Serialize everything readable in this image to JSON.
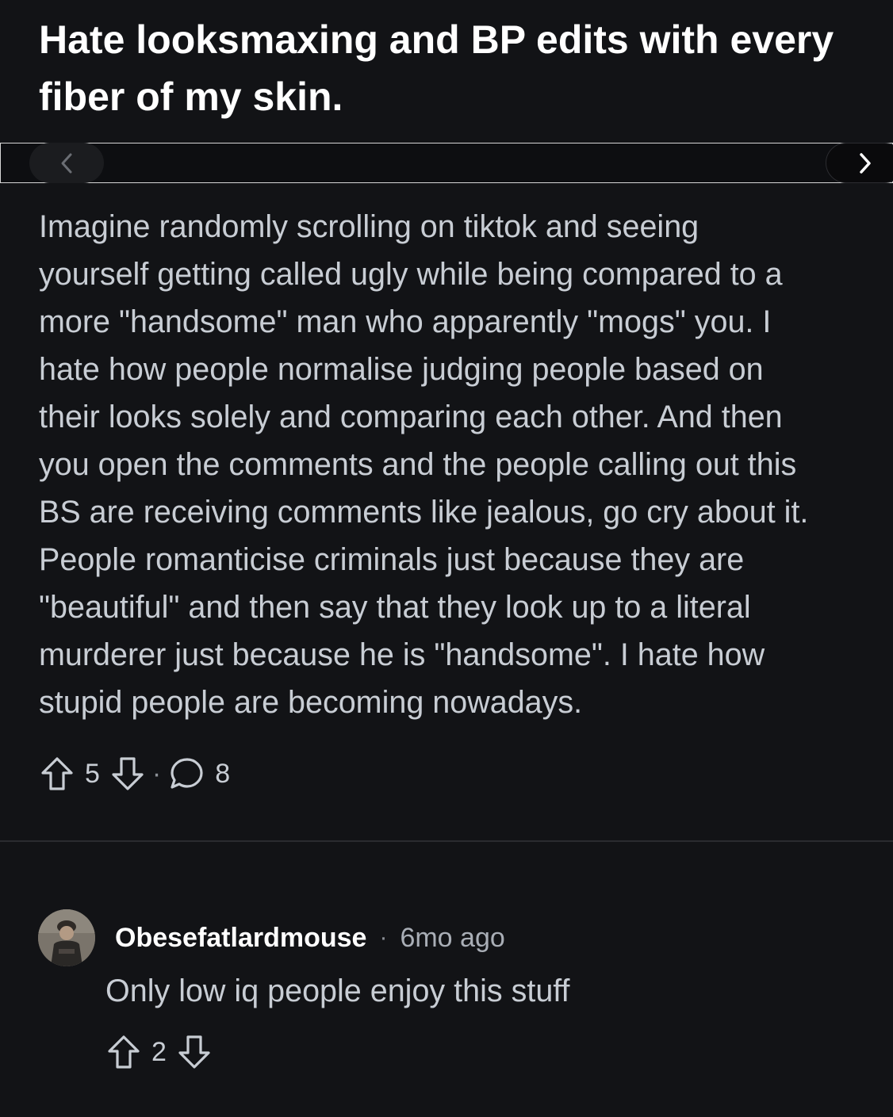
{
  "post": {
    "title": "Hate looksmaxing and BP edits with every fiber of my skin.",
    "body_lines": [
      "Imagine randomly scrolling on tiktok and seeing",
      "yourself getting called ugly while being compared to a",
      "more \"handsome\" man who apparently \"mogs\" you. I",
      "hate how people normalise judging people based on",
      "their looks solely and comparing each other. And then",
      "you open the comments and the people calling out this",
      "BS are receiving comments like jealous, go cry about it.",
      "People romanticise criminals just because they are",
      "\"beautiful\" and then say that they look up to a literal",
      "murderer just because he is \"handsome\". I hate how",
      "stupid people are becoming nowadays."
    ],
    "upvotes": "5",
    "separator": "·",
    "comments": "8"
  },
  "carousel": {
    "prev_icon": "chevron-left-icon",
    "next_icon": "chevron-right-icon"
  },
  "comment": {
    "author": "Obesefatlardmouse",
    "separator": "·",
    "age": "6mo ago",
    "text": "Only low iq people enjoy this stuff",
    "upvotes": "2"
  },
  "colors": {
    "background": "#121316",
    "text_primary": "#ffffff",
    "text_body": "#c8cdd4",
    "divider": "#2a2b2f"
  }
}
